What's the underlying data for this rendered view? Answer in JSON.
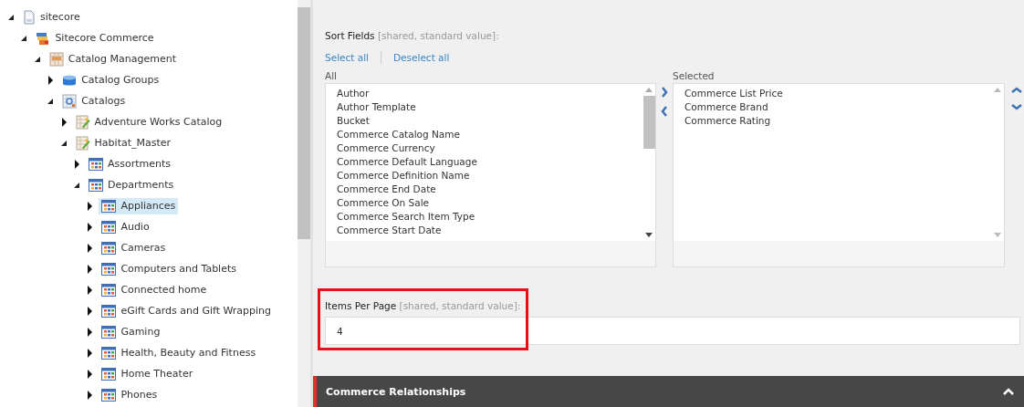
{
  "tree": [
    {
      "label": "sitecore",
      "kind": "document",
      "expanded": true,
      "selected": false,
      "children": [
        {
          "label": "Sitecore Commerce",
          "kind": "commerce",
          "expanded": true,
          "selected": false,
          "children": [
            {
              "label": "Catalog Management",
              "kind": "management",
              "expanded": true,
              "selected": false,
              "children": [
                {
                  "label": "Catalog Groups",
                  "kind": "database",
                  "expanded": false,
                  "selected": false
                },
                {
                  "label": "Catalogs",
                  "kind": "catalogs",
                  "expanded": true,
                  "selected": false,
                  "children": [
                    {
                      "label": "Adventure Works Catalog",
                      "kind": "catalog",
                      "expanded": false,
                      "selected": false
                    },
                    {
                      "label": "Habitat_Master",
                      "kind": "catalog",
                      "expanded": true,
                      "selected": false,
                      "children": [
                        {
                          "label": "Assortments",
                          "kind": "category",
                          "expanded": false,
                          "selected": false
                        },
                        {
                          "label": "Departments",
                          "kind": "category",
                          "expanded": true,
                          "selected": false,
                          "children": [
                            {
                              "label": "Appliances",
                              "kind": "category",
                              "expanded": false,
                              "selected": true
                            },
                            {
                              "label": "Audio",
                              "kind": "category",
                              "expanded": false,
                              "selected": false
                            },
                            {
                              "label": "Cameras",
                              "kind": "category",
                              "expanded": false,
                              "selected": false
                            },
                            {
                              "label": "Computers and Tablets",
                              "kind": "category",
                              "expanded": false,
                              "selected": false
                            },
                            {
                              "label": "Connected home",
                              "kind": "category",
                              "expanded": false,
                              "selected": false
                            },
                            {
                              "label": "eGift Cards and Gift Wrapping",
                              "kind": "category",
                              "expanded": false,
                              "selected": false
                            },
                            {
                              "label": "Gaming",
                              "kind": "category",
                              "expanded": false,
                              "selected": false
                            },
                            {
                              "label": "Health, Beauty and Fitness",
                              "kind": "category",
                              "expanded": false,
                              "selected": false
                            },
                            {
                              "label": "Home Theater",
                              "kind": "category",
                              "expanded": false,
                              "selected": false
                            },
                            {
                              "label": "Phones",
                              "kind": "category",
                              "expanded": false,
                              "selected": false
                            }
                          ]
                        }
                      ]
                    }
                  ]
                }
              ]
            }
          ]
        }
      ]
    }
  ],
  "sort_fields": {
    "label": "Sort Fields",
    "note": "[shared, standard value]:",
    "select_all": "Select all",
    "deselect_all": "Deselect all",
    "all_label": "All",
    "all_items": [
      "Author",
      "Author Template",
      "Bucket",
      "Commerce Catalog Name",
      "Commerce Currency",
      "Commerce Default Language",
      "Commerce Definition Name",
      "Commerce End Date",
      "Commerce On Sale",
      "Commerce Search Item Type",
      "Commerce Start Date"
    ],
    "selected_label": "Selected",
    "selected_items": [
      "Commerce List Price",
      "Commerce Brand",
      "Commerce Rating"
    ]
  },
  "items_per_page": {
    "label": "Items Per Page",
    "note": "[shared, standard value]:",
    "value": "4",
    "highlighted": true
  },
  "section": {
    "title": "Commerce Relationships",
    "expanded": true
  }
}
